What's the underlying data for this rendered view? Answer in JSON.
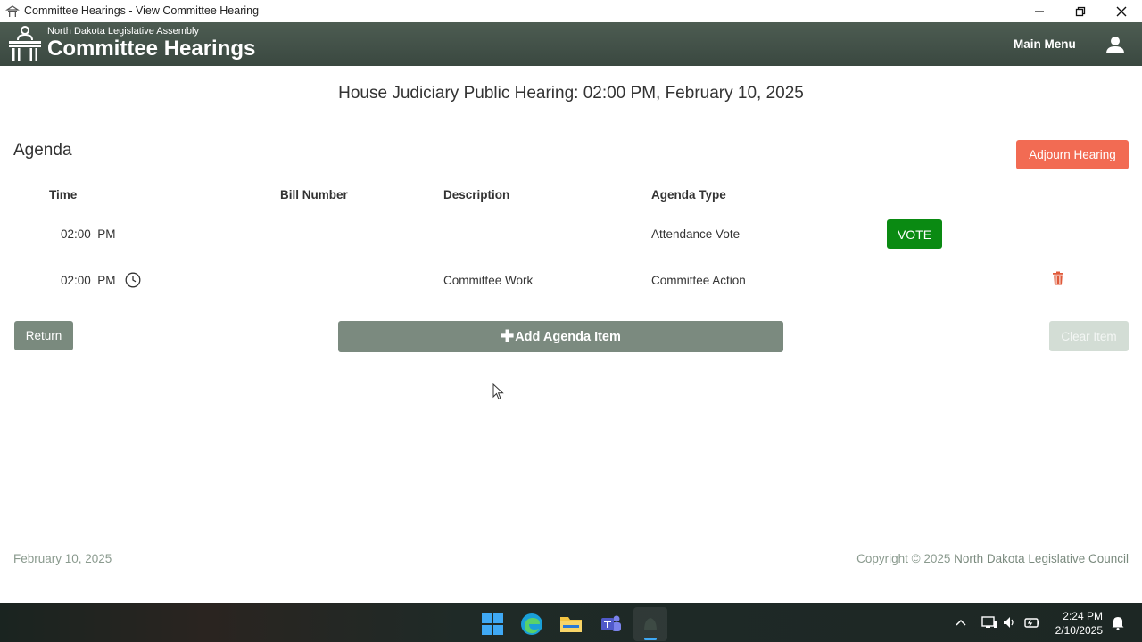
{
  "window": {
    "title": "Committee Hearings - View Committee Hearing"
  },
  "header": {
    "org": "North Dakota Legislative Assembly",
    "app_title": "Committee Hearings",
    "main_menu": "Main Menu"
  },
  "hearing": {
    "title": "House Judiciary Public Hearing: 02:00 PM, February 10, 2025"
  },
  "agenda": {
    "title": "Agenda",
    "adjourn_label": "Adjourn Hearing",
    "columns": {
      "time": "Time",
      "bill": "Bill Number",
      "description": "Description",
      "type": "Agenda Type"
    },
    "rows": [
      {
        "time": "02:00  PM",
        "bill": "",
        "description": "",
        "type": "Attendance Vote",
        "action": "VOTE"
      },
      {
        "time": "02:00  PM",
        "bill": "",
        "description": "Committee Work",
        "type": "Committee Action"
      }
    ],
    "return_label": "Return",
    "add_label": "Add Agenda Item",
    "clear_label": "Clear Item"
  },
  "footer": {
    "date": "February 10, 2025",
    "copyright": "Copyright © 2025 ",
    "council": "North Dakota Legislative Council"
  },
  "taskbar": {
    "time": "2:24 PM",
    "date": "2/10/2025"
  },
  "colors": {
    "header": "#3f4d45",
    "adjourn": "#f26b53",
    "vote": "#0a8a12",
    "button": "#7b8a7f",
    "trash": "#e05a3a"
  }
}
